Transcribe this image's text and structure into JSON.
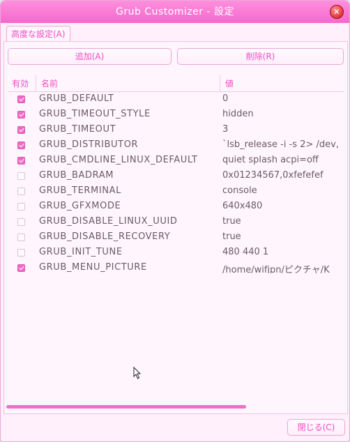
{
  "window": {
    "title": "Grub Customizer - 設定"
  },
  "tab": {
    "label": "高度な設定(A)"
  },
  "toolbar": {
    "add_label": "追加(A)",
    "delete_label": "削除(R)"
  },
  "table": {
    "headers": {
      "enabled": "有効",
      "name": "名前",
      "value": "値"
    },
    "rows": [
      {
        "enabled": true,
        "name": "GRUB_DEFAULT",
        "value": "0"
      },
      {
        "enabled": true,
        "name": "GRUB_TIMEOUT_STYLE",
        "value": "hidden"
      },
      {
        "enabled": true,
        "name": "GRUB_TIMEOUT",
        "value": "3"
      },
      {
        "enabled": true,
        "name": "GRUB_DISTRIBUTOR",
        "value": "`lsb_release -i -s 2> /dev,"
      },
      {
        "enabled": true,
        "name": "GRUB_CMDLINE_LINUX_DEFAULT",
        "value": "quiet splash acpi=off"
      },
      {
        "enabled": false,
        "name": "GRUB_BADRAM",
        "value": "0x01234567,0xfefefef"
      },
      {
        "enabled": false,
        "name": "GRUB_TERMINAL",
        "value": "console"
      },
      {
        "enabled": false,
        "name": "GRUB_GFXMODE",
        "value": "640x480"
      },
      {
        "enabled": false,
        "name": "GRUB_DISABLE_LINUX_UUID",
        "value": "true"
      },
      {
        "enabled": false,
        "name": "GRUB_DISABLE_RECOVERY",
        "value": "true"
      },
      {
        "enabled": false,
        "name": "GRUB_INIT_TUNE",
        "value": "480 440 1"
      },
      {
        "enabled": true,
        "name": "GRUB_MENU_PICTURE",
        "value": "/home/wifjpn/ピクチャ/K"
      }
    ]
  },
  "footer": {
    "close_label": "閉じる(C)"
  },
  "colors": {
    "accent": "#ef4cc2",
    "titlebar": "#f468cc",
    "background": "#fff0fb"
  }
}
